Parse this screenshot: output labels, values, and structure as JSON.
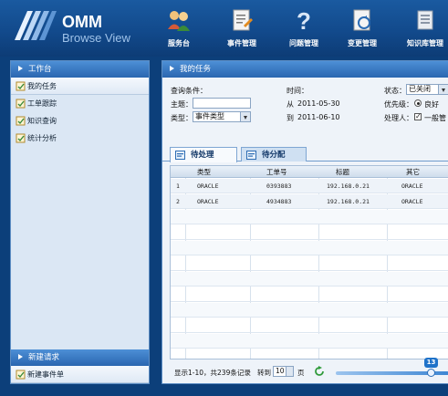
{
  "brand": {
    "title": "OMM",
    "subtitle": "Browse View"
  },
  "nav": [
    {
      "label": "服务台",
      "icon": "people-icon"
    },
    {
      "label": "事件管理",
      "icon": "document-icon"
    },
    {
      "label": "问题管理",
      "icon": "question-icon"
    },
    {
      "label": "变更管理",
      "icon": "change-icon"
    },
    {
      "label": "知识库管理",
      "icon": "knowledge-icon"
    }
  ],
  "sidebar": {
    "header": "工作台",
    "items": [
      {
        "label": "我的任务",
        "icon": "task-icon",
        "active": true
      },
      {
        "label": "工单跟踪",
        "icon": "task-icon"
      },
      {
        "label": "知识查询",
        "icon": "task-icon"
      },
      {
        "label": "统计分析",
        "icon": "task-icon"
      }
    ],
    "new_header": "新建请求",
    "new_item": "新建事件单"
  },
  "main": {
    "header": "我的任务",
    "query": {
      "title": "查询条件：",
      "subject_label": "主题：",
      "subject_value": "",
      "type_label": "类型：",
      "type_value": "事件类型",
      "time_label": "时间：",
      "from_label": "从",
      "from_value": "2011-05-30",
      "to_label": "到",
      "to_value": "2011-06-10",
      "status_label": "状态：",
      "status_value": "已关闭",
      "priority_label": "优先级：",
      "priority_value": "良好",
      "handler_label": "处理人：",
      "handler_value": "一般管"
    },
    "tabs": [
      {
        "label": "待处理",
        "icon": "pending-icon",
        "active": true
      },
      {
        "label": "待分配",
        "icon": "assign-icon"
      }
    ],
    "columns": [
      "类型",
      "工单号",
      "标题",
      "其它"
    ],
    "rows": [
      {
        "num": "1",
        "type": "ORACLE",
        "ticket": "0393883",
        "title": "192.168.0.21",
        "other": "ORACLE"
      },
      {
        "num": "2",
        "type": "ORACLE",
        "ticket": "4934883",
        "title": "192.168.0.21",
        "other": "ORACLE"
      }
    ],
    "pager": {
      "summary": "显示1-10，共239条记录",
      "goto_label": "转到",
      "goto_value": "10",
      "page_label": "页",
      "slider_value": "13"
    }
  }
}
